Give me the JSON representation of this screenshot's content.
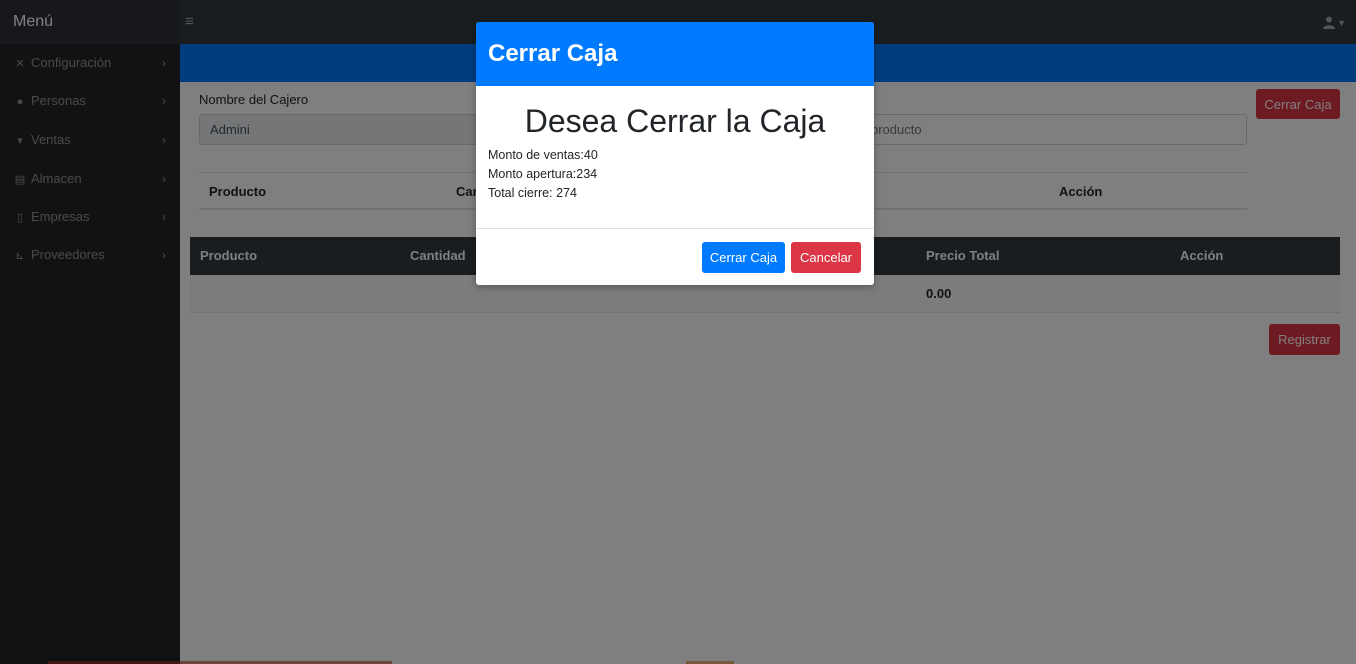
{
  "navbar": {
    "brand": "Menú",
    "menu_toggle_icon": "≡",
    "user_icon": "user-icon"
  },
  "sidebar": {
    "items": [
      {
        "label": "Configuración",
        "icon": "tools-icon"
      },
      {
        "label": "Personas",
        "icon": "users-icon"
      },
      {
        "label": "Ventas",
        "icon": "cart-icon"
      },
      {
        "label": "Almacen",
        "icon": "warehouse-icon"
      },
      {
        "label": "Empresas",
        "icon": "building-icon"
      },
      {
        "label": "Proveedores",
        "icon": "dolly-icon"
      }
    ]
  },
  "form": {
    "cajero_label": "Nombre del Cajero",
    "cajero_value": "Admini",
    "producto_placeholder": "producto",
    "cerrar_caja_button": "Cerrar Caja"
  },
  "table_search": {
    "headers": [
      "Producto",
      "Can",
      "Acción"
    ]
  },
  "table_cart": {
    "headers": [
      "Producto",
      "Cantidad",
      "Precio Total",
      "Acción"
    ],
    "total": "0.00"
  },
  "registrar_button": "Registrar",
  "modal": {
    "title": "Cerrar Caja",
    "heading": "Desea Cerrar la Caja",
    "monto_ventas": "Monto de ventas:40",
    "monto_apertura": "Monto apertura:234",
    "total_cierre": "Total cierre: 274",
    "confirm_button": "Cerrar Caja",
    "cancel_button": "Cancelar"
  },
  "colors": {
    "primary": "#007bff",
    "danger": "#dc3545",
    "dark": "#343a40"
  }
}
